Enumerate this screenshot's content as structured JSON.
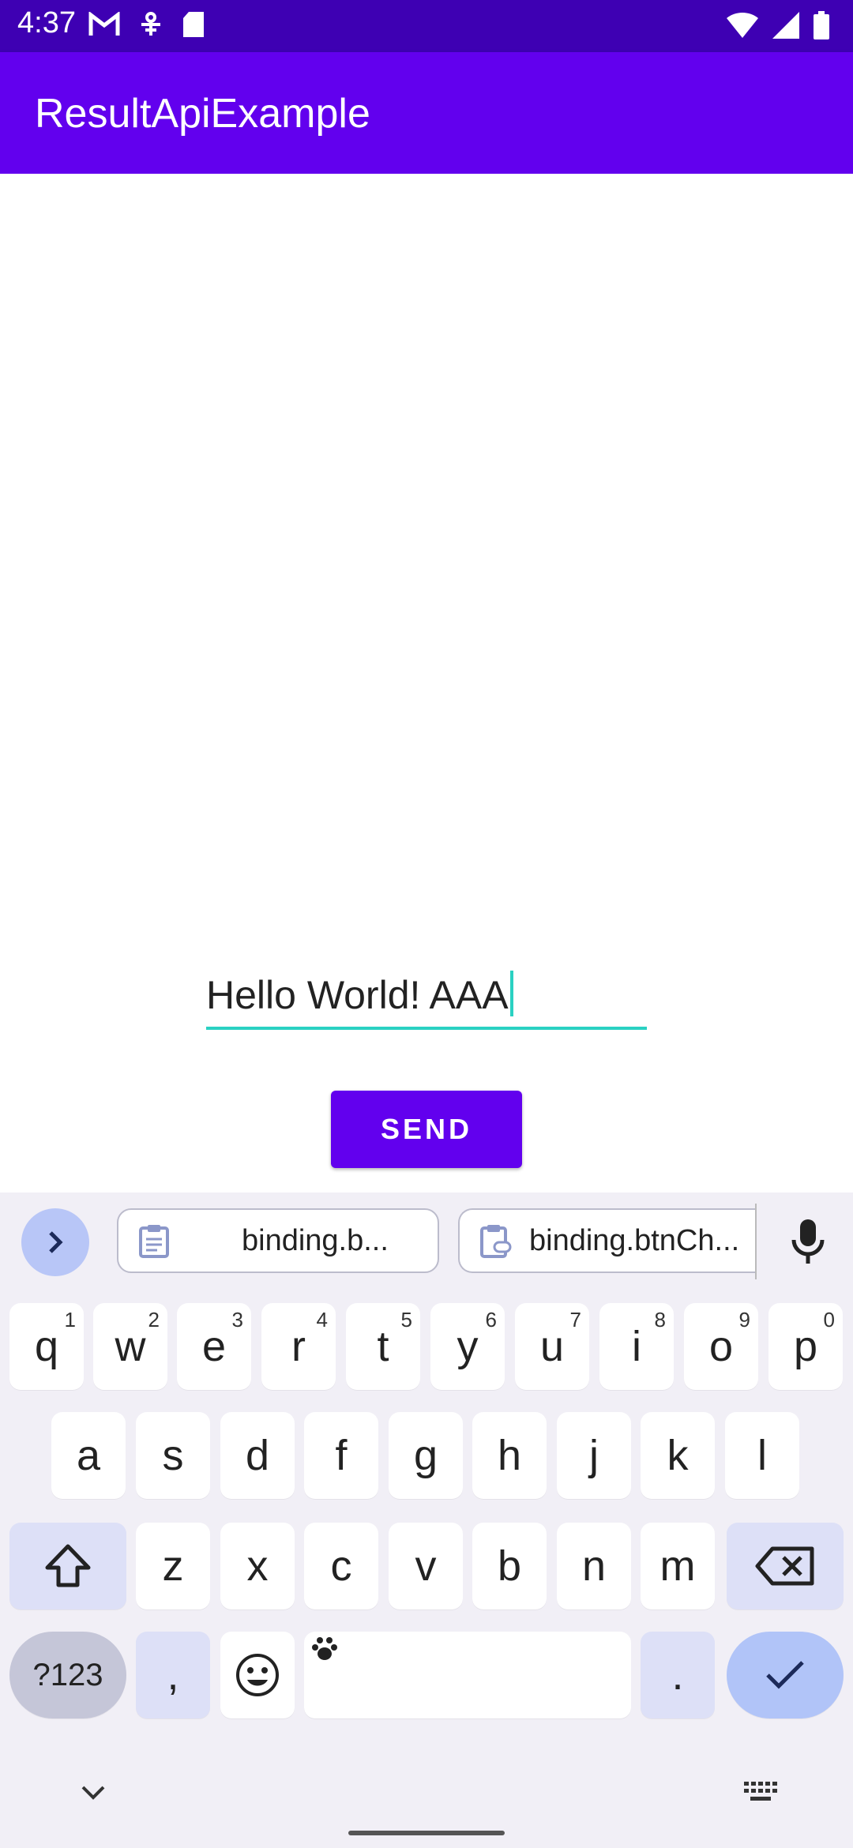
{
  "status_bar": {
    "time": "4:37",
    "left_icons": [
      "gmail-icon",
      "accessibility-icon",
      "sd-card-icon"
    ],
    "right_icons": [
      "wifi-icon",
      "signal-icon",
      "battery-icon"
    ]
  },
  "app_bar": {
    "title": "ResultApiExample",
    "color": "#6200ee"
  },
  "form": {
    "text_value": "Hello World! AAA",
    "send_label": "SEND",
    "underline_color": "#2ad1c2"
  },
  "keyboard": {
    "suggestions": [
      "binding.b...",
      "binding.btnCh..."
    ],
    "row1": [
      {
        "k": "q",
        "n": "1"
      },
      {
        "k": "w",
        "n": "2"
      },
      {
        "k": "e",
        "n": "3"
      },
      {
        "k": "r",
        "n": "4"
      },
      {
        "k": "t",
        "n": "5"
      },
      {
        "k": "y",
        "n": "6"
      },
      {
        "k": "u",
        "n": "7"
      },
      {
        "k": "i",
        "n": "8"
      },
      {
        "k": "o",
        "n": "9"
      },
      {
        "k": "p",
        "n": "0"
      }
    ],
    "row2": [
      "a",
      "s",
      "d",
      "f",
      "g",
      "h",
      "j",
      "k",
      "l"
    ],
    "row3": [
      "z",
      "x",
      "c",
      "v",
      "b",
      "n",
      "m"
    ],
    "sym_label": "?123",
    "comma": ",",
    "period": "."
  }
}
